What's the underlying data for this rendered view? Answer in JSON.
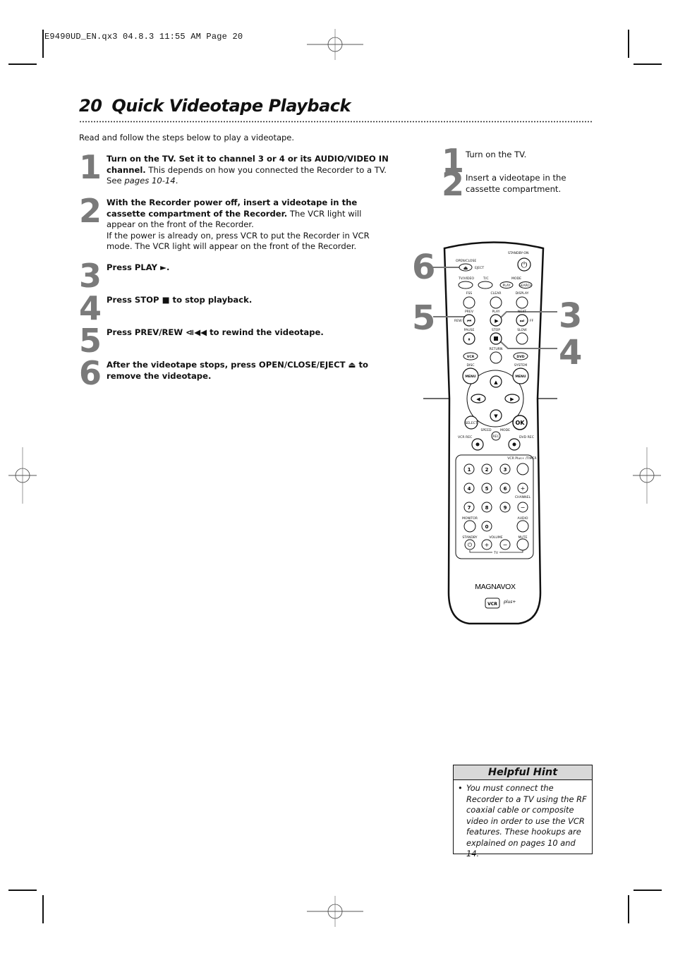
{
  "slug": "E9490UD_EN.qx3  04.8.3  11:55 AM  Page 20",
  "page": {
    "number": "20",
    "title": "Quick Videotape Playback",
    "intro": "Read and follow the steps below to play a videotape."
  },
  "steps": [
    {
      "num": "1",
      "bold": "Turn on the TV. Set it to channel 3 or 4 or its AUDIO/VIDEO IN channel.",
      "text": " This depends on how you connected the Recorder to a TV. See ",
      "italic": "pages 10-14",
      "tail": "."
    },
    {
      "num": "2",
      "bold": "With the Recorder power off, insert a videotape in the cassette compartment of the Recorder.",
      "text": " The VCR light will appear on the front of the Recorder.",
      "extra": "If the power is already on, press VCR to put the Recorder in VCR mode. The VCR light will appear on the front of the Recorder."
    },
    {
      "num": "3",
      "bold": "Press PLAY ►."
    },
    {
      "num": "4",
      "bold": "Press STOP ■ to stop playback."
    },
    {
      "num": "5",
      "bold": "Press PREV/REW ⧏◀◀ to rewind the videotape."
    },
    {
      "num": "6",
      "bold": "After the videotape stops, press OPEN/CLOSE/EJECT ⏏ to remove the videotape."
    }
  ],
  "quick_steps": [
    {
      "num": "1",
      "text": "Turn on the TV."
    },
    {
      "num": "2",
      "text": "Insert a videotape in the cassette compartment."
    }
  ],
  "callouts": {
    "c6": "6",
    "c5": "5",
    "c3": "3",
    "c4": "4"
  },
  "remote": {
    "brand": "MAGNAVOX",
    "logo": "VCR plus+",
    "labels": {
      "standby_on": "STANDBY-ON",
      "open_close": "OPEN/CLOSE",
      "eject": "EJECT",
      "tv_video": "TV/VIDEO",
      "tc": "T/C",
      "mode": "MODE",
      "play_mode": "PLAY",
      "search": "SEARCH",
      "fss": "FSS",
      "clear": "CLEAR",
      "display": "DISPLAY",
      "prev": "PREV",
      "rew": "REW",
      "play": "PLAY",
      "next": "NEXT",
      "ff": "FF",
      "pause": "PAUSE",
      "stop": "STOP",
      "slow": "SLOW",
      "return": "RETURN",
      "vcr": "VCR",
      "dvd": "DVD",
      "disc": "DISC",
      "system": "SYSTEM",
      "menu": "MENU",
      "select": "SELECT",
      "ok": "OK",
      "speed": "SPEED",
      "mode2": "MODE",
      "rec": "REC",
      "vcr_rec": "VCR REC",
      "dvd_rec": "DVD REC",
      "vcr_plus_timer": "VCR Plus+ /TIMER",
      "channel": "CHANNEL",
      "monitor": "MONITOR",
      "audio": "AUDIO",
      "standby": "STANDBY",
      "volume": "VOLUME",
      "mute": "MUTE",
      "tv": "TV"
    },
    "digits": [
      "1",
      "2",
      "3",
      "4",
      "5",
      "6",
      "7",
      "8",
      "9",
      "0"
    ]
  },
  "hint": {
    "title": "Helpful Hint",
    "bullet": "•",
    "text": "You must connect the Recorder to a TV using the RF coaxial cable or composite video in order to use the VCR features. These hookups are explained on pages 10 and 14."
  }
}
